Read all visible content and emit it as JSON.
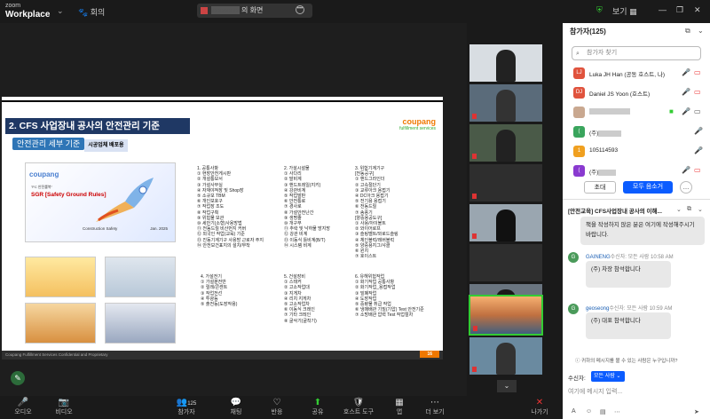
{
  "app": {
    "logo_small": "zoom",
    "logo_big": "Workplace",
    "meeting_tab": "회의",
    "screen_tab": "의 화면",
    "view_label": "보기"
  },
  "slide": {
    "title": "2. CFS 사업장내 공사의 안전관리 기준",
    "brand": "coupang",
    "brand_sub": "fulfillment services",
    "subtitle": "안전관리 세부 기준",
    "subtitle_tag": "시공업체 배포용",
    "cover": {
      "brand": "coupang",
      "line1": "\"FC 안전룰북\"",
      "line2": "SGR [Safety Ground Rules]",
      "line3": "Construction Safety",
      "date": "Jan. 2025"
    },
    "sections": [
      {
        "text": "1. 공통사항\n① 현장안전게시판\n② 개설통보서\n③ 가설사무실\n④ 자재야적장 및 Shop장\n⑤ 소규모 TBM\n⑥ 개인보호구\n⑦ 작업장 조도\n⑧ 작업구획\n⑨ 위험물 보관\n⑩ 세안기(소형)사용방법\n⑪ 전동드릴 비산먼지 커버\n⑫ 외국인 작업(교육) 기준\n⑬ 진동기계기구 사용방 근로자 주지\n⑭ 안전보건표지의 설치/부착"
      },
      {
        "text": "2. 가설시설물\n① 사다리\n② 말비계\n③ 핸드트레일(지키)\n④ 강관비계\n⑤ 작업발판\n⑥ 안전통로\n⑦ 경사로\n⑧ 가설안전난간\n⑨ 생명줄\n⑩ 개구부\n⑪ 추락 및 낙하물 방지망\n⑫ 강관 비계\n⑬ 이동식 틀비계(B/T)\n⑭ 시스템 비계"
      },
      {
        "text": "3. 위험기계기구\n[전동공구]\n① 핸드그라인더\n② 고속절단기\n③ 교류아크 용접기\n④ DC아크 용접기\n⑤ 전기용 용접기\n⑥ 전동드릴\n⑦ 송풍기\n[양중용공도구]\n① 사용/아이볼트\n② 와이어로프\n③ 슬링벨트/와로드슬링\n④ 체인블럭/레버블럭\n⑤ 양중용지그/샤클\n⑥ 윈치\n⑦ 호이스트"
      },
      {
        "text": "4. 가설전기\n① 가설분전반\n② 릴레/콘센트\n③ 작업전선\n④ 투광등\n⑤ 출전등(도장작용)"
      },
      {
        "text": "5. 건설장비\n① 스태커\n② 고소작업대\n③ 지게차\n④ 리치 지게차\n⑤ 고소작업차\n⑥ 이동식 크레인\n⑦ 기타 크레인\n⑧ 굴삭기(굴착기)"
      },
      {
        "text": "6. 유해위험작업\n① 화기작업 공통사항\n② 화기작업_용접작업\n③ 밀폐작업\n④ 도장작업\n⑤ 중량물 취급 작업\n⑥ 냉매배관 기밀(기압) Test 안전기준\n⑦ 소방배관 압력 Test 작업절차"
      }
    ],
    "footer": "Coupang Fulfillment Services Confidential and Proprietary",
    "page": "16"
  },
  "toolbar": [
    {
      "label": "오디오",
      "icon": "🎤"
    },
    {
      "label": "비디오",
      "icon": "📷"
    },
    {
      "label": "참가자",
      "icon": "👥",
      "count": "125"
    },
    {
      "label": "채팅",
      "icon": "💬"
    },
    {
      "label": "반응",
      "icon": "♡"
    },
    {
      "label": "공유",
      "icon": "⬆"
    },
    {
      "label": "호스트 도구",
      "icon": "🛡"
    },
    {
      "label": "앱",
      "icon": "▦"
    },
    {
      "label": "더 보기",
      "icon": "⋯"
    },
    {
      "label": "나가기",
      "icon": "✕"
    }
  ],
  "panel": {
    "title": "참가자(125)",
    "search_placeholder": "참가자 찾기",
    "participants": [
      {
        "initials": "LJ",
        "color": "#e0533d",
        "name": "Luka JH Han (공동 호스트, 나)"
      },
      {
        "initials": "DJ",
        "color": "#e0533d",
        "name": "Daniel JS Yoon (호스트)"
      },
      {
        "initials": "",
        "color": "#888888",
        "name": ""
      },
      {
        "initials": "(",
        "color": "#3aa55d",
        "name": "(주)"
      },
      {
        "initials": "1",
        "color": "#f0a020",
        "name": "105114593"
      },
      {
        "initials": "(",
        "color": "#8a3ad0",
        "name": "(주)"
      }
    ],
    "invite": "초대",
    "mute_all": "모두 음소거",
    "chat_title": "[안전교육] CFS사업장내 공사의 이해...",
    "msg_a": "책을 작성하지 않은 분은 여기에 작성해주시기 바랍니다.",
    "msgs": [
      {
        "from": "GAINENG",
        "to": "수신자: 모든 사람",
        "time": "10:58 AM",
        "avatar": "G",
        "text": "(주) 차장 참석합니다"
      },
      {
        "from": "geoseong",
        "to": "수신자: 모든 사람",
        "time": "10:59 AM",
        "avatar": "G",
        "text": "(주) 대표 참석합니다"
      }
    ],
    "hint": "귀하의 메시지를 볼 수 있는 사람은 누구입니까?",
    "to_label": "수신자:",
    "to_select": "모든 사람",
    "input_placeholder": "여기에 메시지 입력..."
  },
  "video_names": [
    "",
    "",
    "",
    "",
    "",
    "",
    "",
    "",
    ""
  ]
}
